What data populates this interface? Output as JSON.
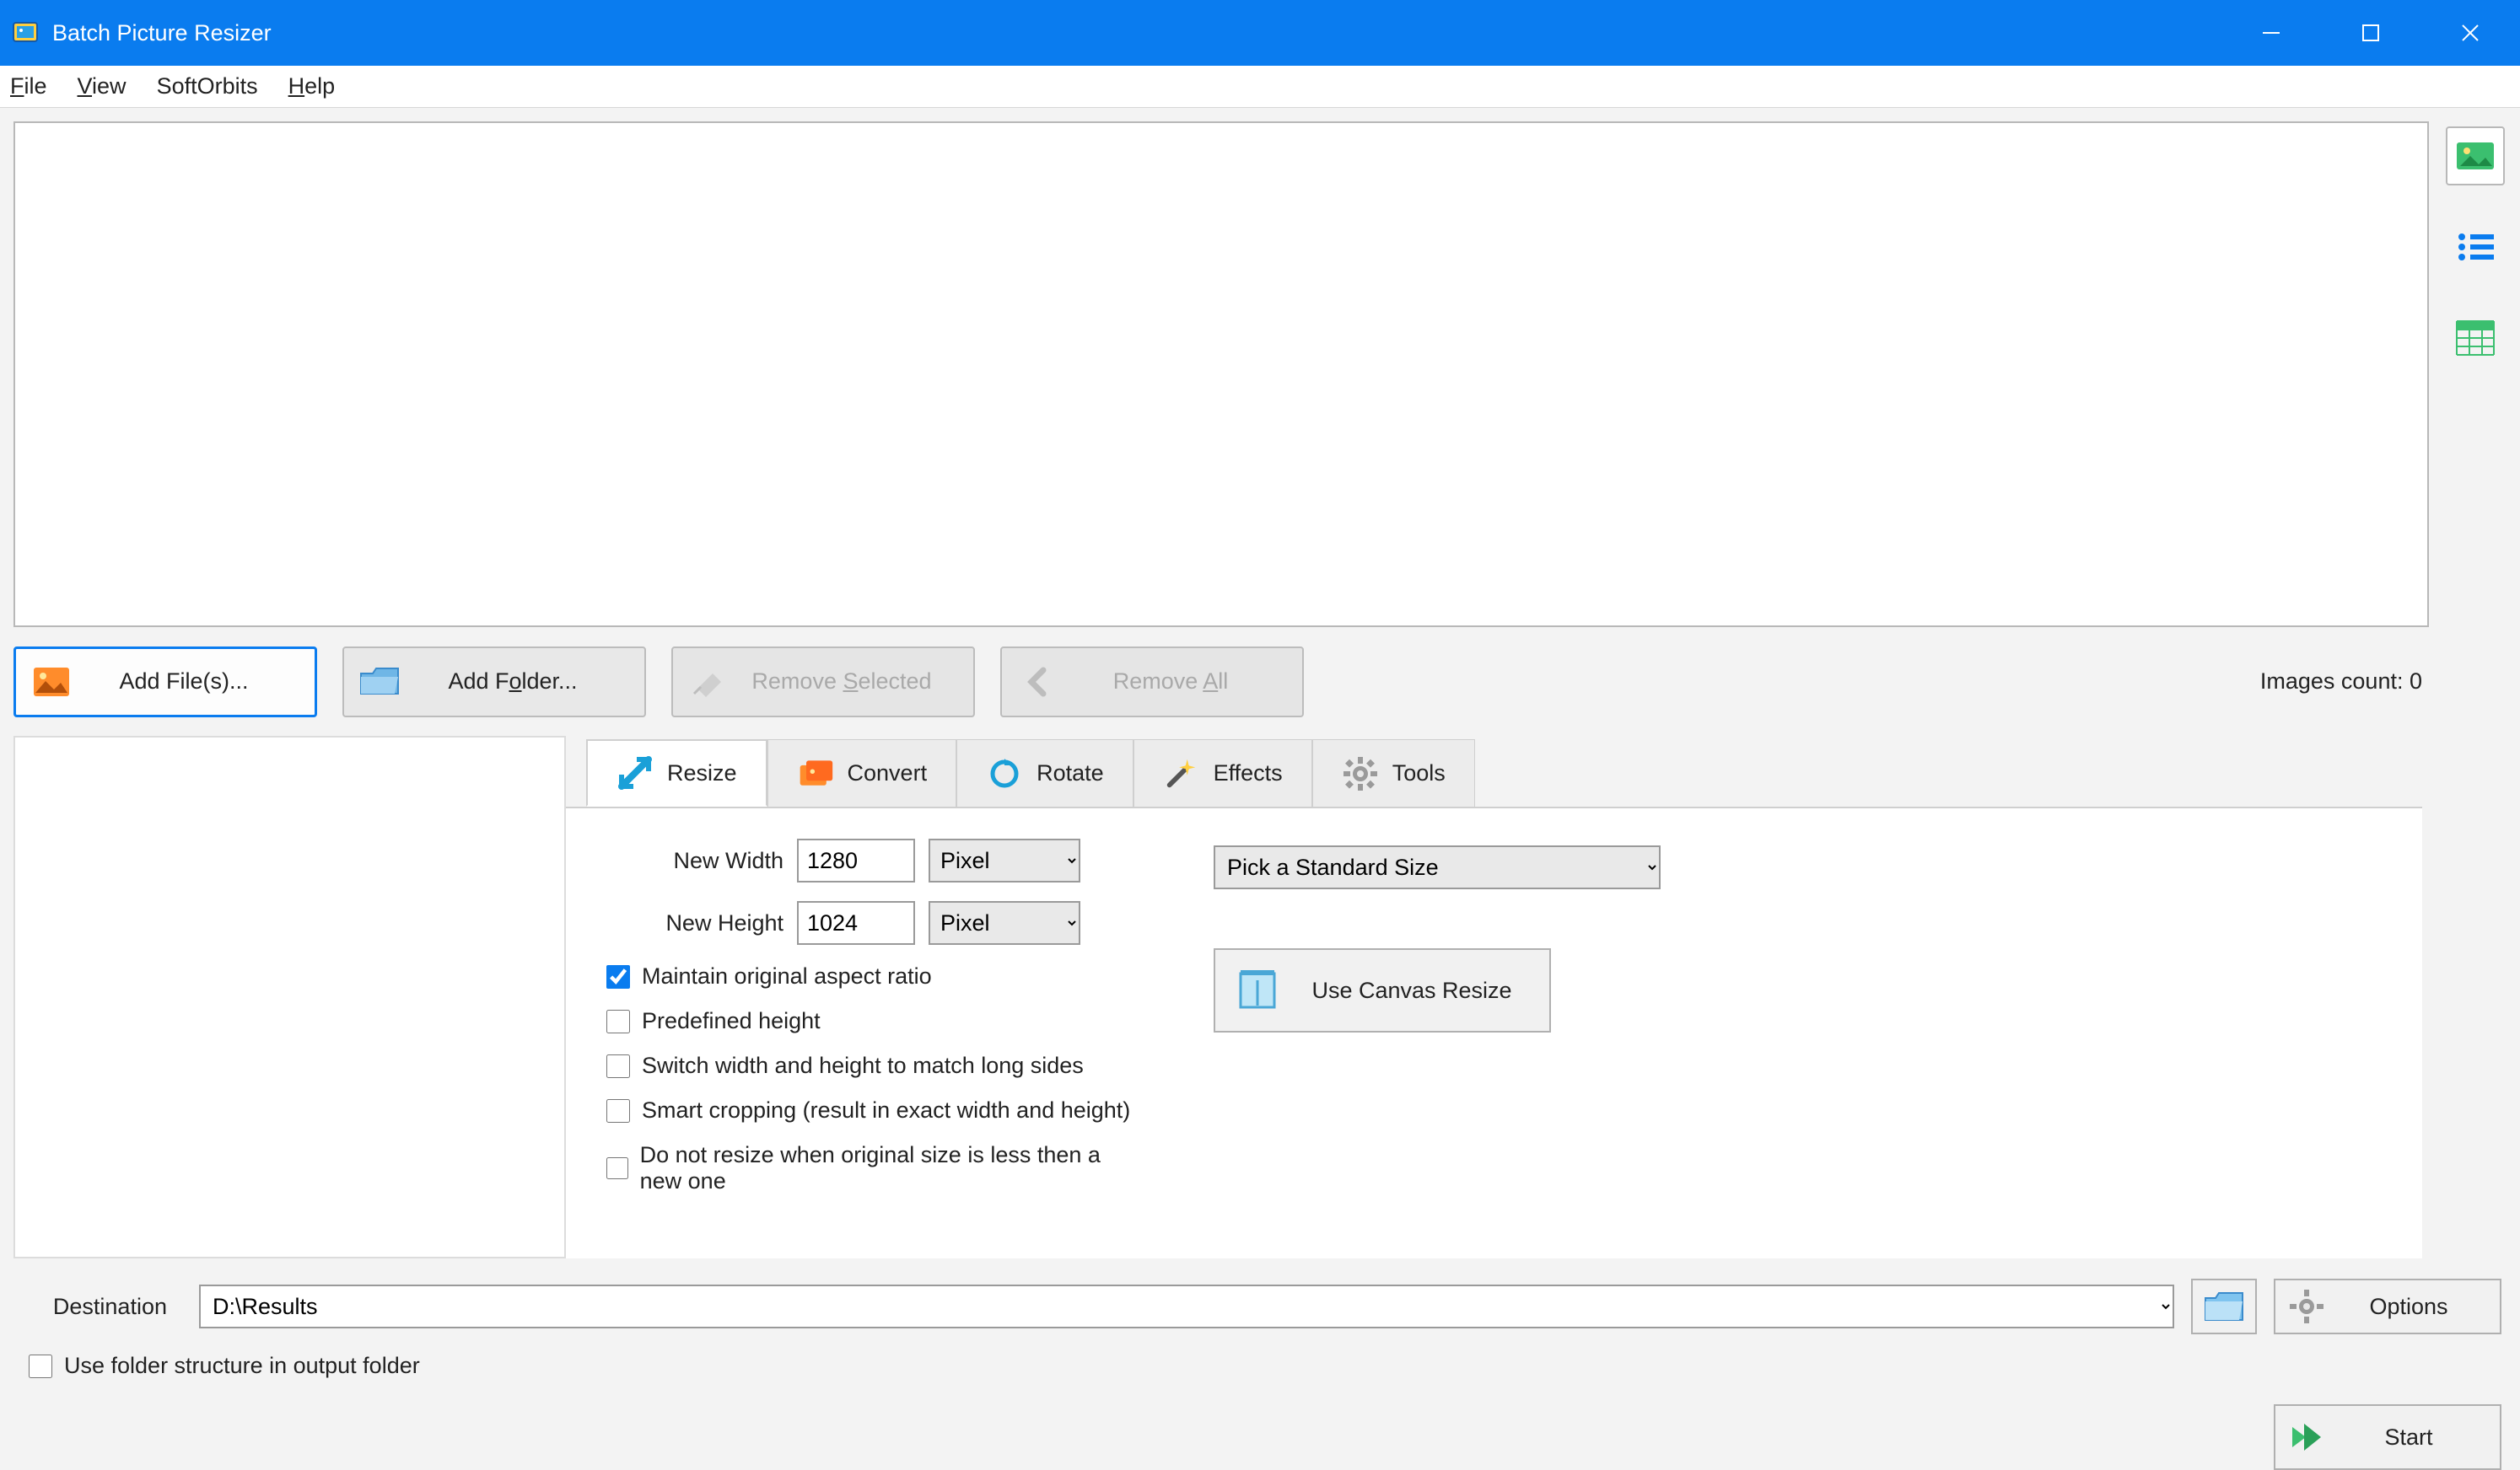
{
  "window": {
    "title": "Batch Picture Resizer"
  },
  "menu": {
    "file": "File",
    "view": "View",
    "softorbits": "SoftOrbits",
    "help": "Help"
  },
  "buttons": {
    "add_files": "Add File(s)...",
    "add_folder": "Add Folder...",
    "remove_selected_pre": "Remove ",
    "remove_selected_ul": "S",
    "remove_selected_post": "elected",
    "remove_all_pre": "Remove ",
    "remove_all_ul": "A",
    "remove_all_post": "ll"
  },
  "status": {
    "images_count": "Images count: 0"
  },
  "tabs": {
    "resize": "Resize",
    "convert": "Convert",
    "rotate": "Rotate",
    "effects": "Effects",
    "tools": "Tools"
  },
  "resize": {
    "new_width_label": "New Width",
    "new_width_value": "1280",
    "new_height_label": "New Height",
    "new_height_value": "1024",
    "unit": "Pixel",
    "maintain_aspect": "Maintain original aspect ratio",
    "predefined_height": "Predefined height",
    "switch_long_sides": "Switch width and height to match long sides",
    "smart_cropping": "Smart cropping (result in exact width and height)",
    "no_resize_smaller": "Do not resize when original size is less then a new one",
    "std_size": "Pick a Standard Size",
    "canvas_btn": "Use Canvas Resize"
  },
  "dest": {
    "label": "Destination",
    "value": "D:\\Results",
    "options": "Options",
    "start": "Start",
    "use_folder_structure": "Use folder structure in output folder"
  }
}
